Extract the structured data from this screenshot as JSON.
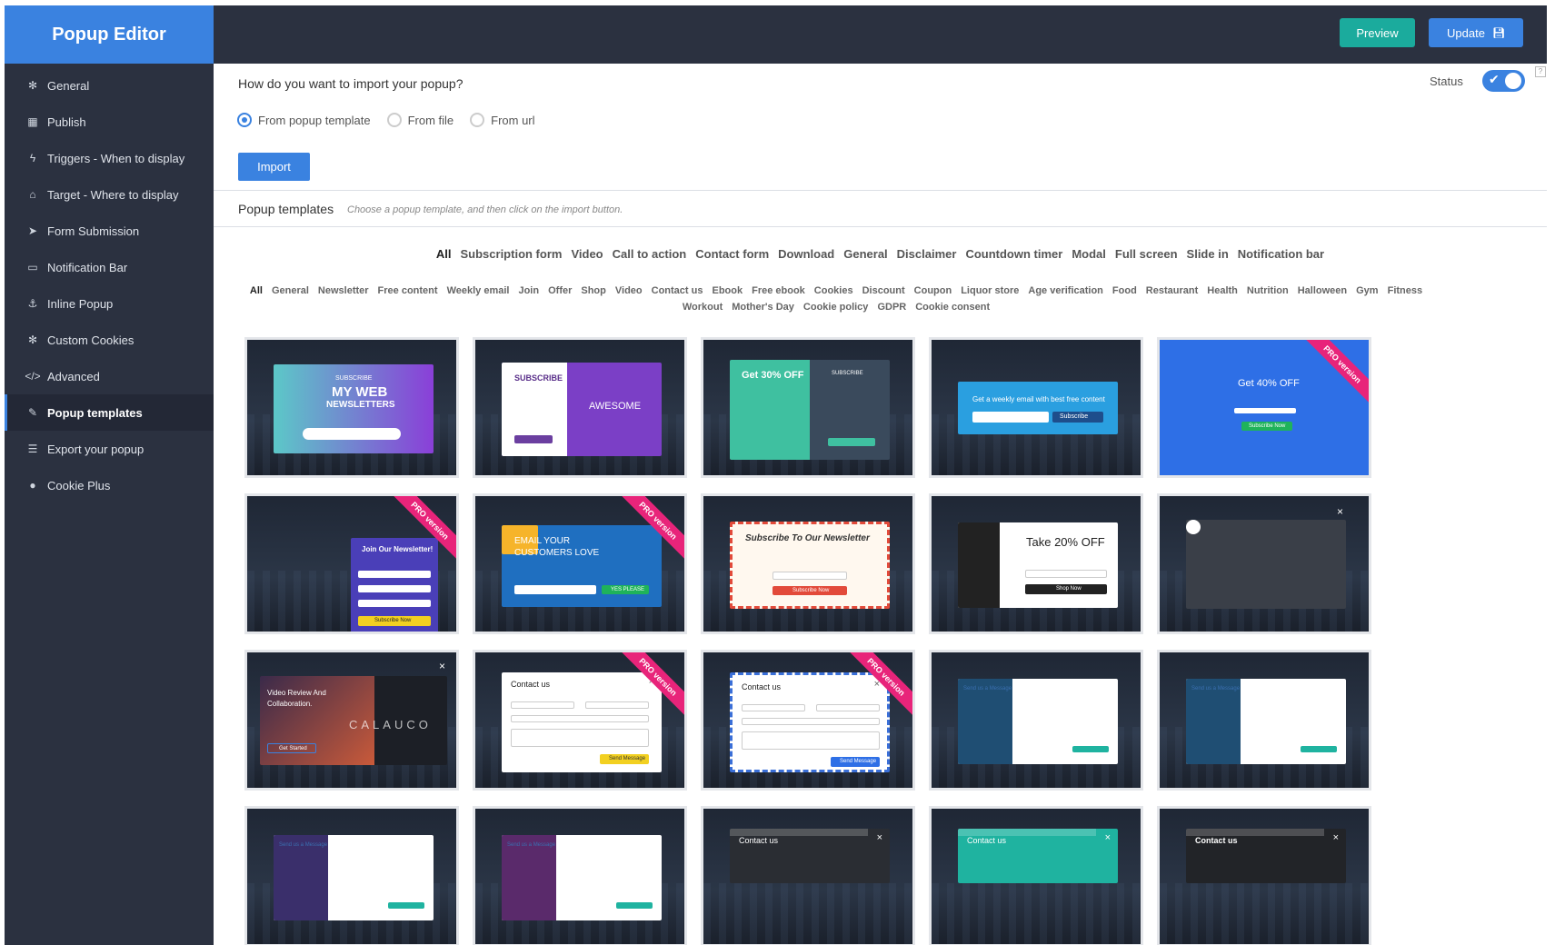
{
  "app": {
    "brand": "Popup Editor"
  },
  "sidebar": {
    "items": [
      {
        "label": "General",
        "icon": "gear-icon",
        "glyph": "✻"
      },
      {
        "label": "Publish",
        "icon": "calendar-icon",
        "glyph": "▦"
      },
      {
        "label": "Triggers - When to display",
        "icon": "bolt-icon",
        "glyph": "ϟ"
      },
      {
        "label": "Target - Where to display",
        "icon": "home-icon",
        "glyph": "⌂"
      },
      {
        "label": "Form Submission",
        "icon": "paper-plane-icon",
        "glyph": "➤"
      },
      {
        "label": "Notification Bar",
        "icon": "credit-card-icon",
        "glyph": "▭"
      },
      {
        "label": "Inline Popup",
        "icon": "anchor-icon",
        "glyph": "⚓"
      },
      {
        "label": "Custom Cookies",
        "icon": "cookie-gear-icon",
        "glyph": "✻"
      },
      {
        "label": "Advanced",
        "icon": "code-icon",
        "glyph": "</>"
      },
      {
        "label": "Popup templates",
        "icon": "paint-brush-icon",
        "glyph": "✎"
      },
      {
        "label": "Export your popup",
        "icon": "database-icon",
        "glyph": "☰"
      },
      {
        "label": "Cookie Plus",
        "icon": "cookie-icon",
        "glyph": "●"
      }
    ],
    "active_index": 9
  },
  "toolbar": {
    "preview_label": "Preview",
    "update_label": "Update",
    "update_icon": "save-icon"
  },
  "import": {
    "question": "How do you want to import your popup?",
    "status_label": "Status",
    "status_on": true,
    "options": [
      "From popup template",
      "From file",
      "From url"
    ],
    "selected": 0,
    "import_label": "Import"
  },
  "templates": {
    "title": "Popup templates",
    "hint": "Choose a popup template, and then click on the import button.",
    "categories": [
      "All",
      "Subscription form",
      "Video",
      "Call to action",
      "Contact form",
      "Download",
      "General",
      "Disclaimer",
      "Countdown timer",
      "Modal",
      "Full screen",
      "Slide in",
      "Notification bar"
    ],
    "tags": [
      "All",
      "General",
      "Newsletter",
      "Free content",
      "Weekly email",
      "Join",
      "Offer",
      "Shop",
      "Video",
      "Contact us",
      "Ebook",
      "Free ebook",
      "Cookies",
      "Discount",
      "Coupon",
      "Liquor store",
      "Age verification",
      "Food",
      "Restaurant",
      "Health",
      "Nutrition",
      "Halloween",
      "Gym",
      "Fitness",
      "Workout",
      "Mother's Day",
      "Cookie policy",
      "GDPR",
      "Cookie consent"
    ],
    "pro_label": "PRO version",
    "cards": [
      {
        "kind": "newsletter",
        "texts": [
          "SUBSCRIBE",
          "MY WEB",
          "NEWSLETTERS"
        ],
        "pro": false,
        "colors": [
          "#5cc8c8",
          "#8a3fd8"
        ]
      },
      {
        "kind": "split",
        "texts": [
          "SUBSCRIBE",
          "AWESOME"
        ],
        "pro": false,
        "colors": [
          "#ffffff",
          "#7b3fc6"
        ]
      },
      {
        "kind": "ebook",
        "texts": [
          "Get 30% OFF",
          "SUBSCRIBE"
        ],
        "pro": false,
        "colors": [
          "#3fc0a0",
          "#3a4a5c"
        ]
      },
      {
        "kind": "weekly",
        "texts": [
          "Get a weekly email with best free content",
          "Subscribe"
        ],
        "pro": false,
        "colors": [
          "#2a9fe0",
          "#1e4e8c"
        ]
      },
      {
        "kind": "offer",
        "texts": [
          "Get 40% OFF",
          "Subscribe Now"
        ],
        "pro": true,
        "colors": [
          "#2e6fe6",
          "#1fb35a"
        ]
      },
      {
        "kind": "join",
        "texts": [
          "Join Our Newsletter!",
          "Subscribe Now"
        ],
        "pro": true,
        "colors": [
          "#4a3fb8",
          "#f2d021"
        ]
      },
      {
        "kind": "email",
        "texts": [
          "EMAIL YOUR",
          "CUSTOMERS LOVE",
          "YES PLEASE"
        ],
        "pro": true,
        "colors": [
          "#1f6fc0",
          "#1fb35a"
        ]
      },
      {
        "kind": "letter",
        "texts": [
          "Subscribe To Our Newsletter",
          "Subscribe Now"
        ],
        "pro": false,
        "colors": [
          "#fff8ef",
          "#e24a3a"
        ]
      },
      {
        "kind": "shop",
        "texts": [
          "Take 20% OFF",
          "Shop Now"
        ],
        "pro": false,
        "colors": [
          "#ffffff",
          "#222222"
        ]
      },
      {
        "kind": "video",
        "texts": [],
        "pro": false,
        "colors": [
          "#3a3f48",
          "#ffffff"
        ]
      },
      {
        "kind": "review",
        "texts": [
          "Video Review And",
          "Collaboration.",
          "Get Started",
          "CALAUCO"
        ],
        "pro": false,
        "colors": [
          "#1c1f26",
          "#c95a3a"
        ]
      },
      {
        "kind": "contact",
        "texts": [
          "Contact us",
          "Send Message"
        ],
        "pro": true,
        "colors": [
          "#ffffff",
          "#f2d021"
        ]
      },
      {
        "kind": "contact2",
        "texts": [
          "Contact us",
          "Send Message"
        ],
        "pro": true,
        "colors": [
          "#ffffff",
          "#2e6fe6"
        ]
      },
      {
        "kind": "message",
        "texts": [
          "Send us a Message",
          "Contact Information"
        ],
        "pro": false,
        "colors": [
          "#ffffff",
          "#1f4e73"
        ]
      },
      {
        "kind": "message",
        "texts": [
          "Send us a Message",
          "Contact Information"
        ],
        "pro": false,
        "colors": [
          "#ffffff",
          "#1f4e73"
        ]
      },
      {
        "kind": "message",
        "texts": [
          "Send us a Message",
          "Contact Information"
        ],
        "pro": false,
        "colors": [
          "#ffffff",
          "#3a2f6b"
        ]
      },
      {
        "kind": "message",
        "texts": [
          "Send us a Message",
          "Contact Information"
        ],
        "pro": false,
        "colors": [
          "#ffffff",
          "#5a2a6b"
        ]
      },
      {
        "kind": "dark",
        "texts": [
          "Contact us"
        ],
        "pro": false,
        "colors": [
          "#2a2d33",
          "#ffffff"
        ]
      },
      {
        "kind": "dark",
        "texts": [
          "Contact us"
        ],
        "pro": false,
        "colors": [
          "#1fb3a0",
          "#ffffff"
        ]
      },
      {
        "kind": "dark2",
        "texts": [
          "Contact us"
        ],
        "pro": false,
        "colors": [
          "#222428",
          "#ffffff"
        ]
      }
    ]
  }
}
